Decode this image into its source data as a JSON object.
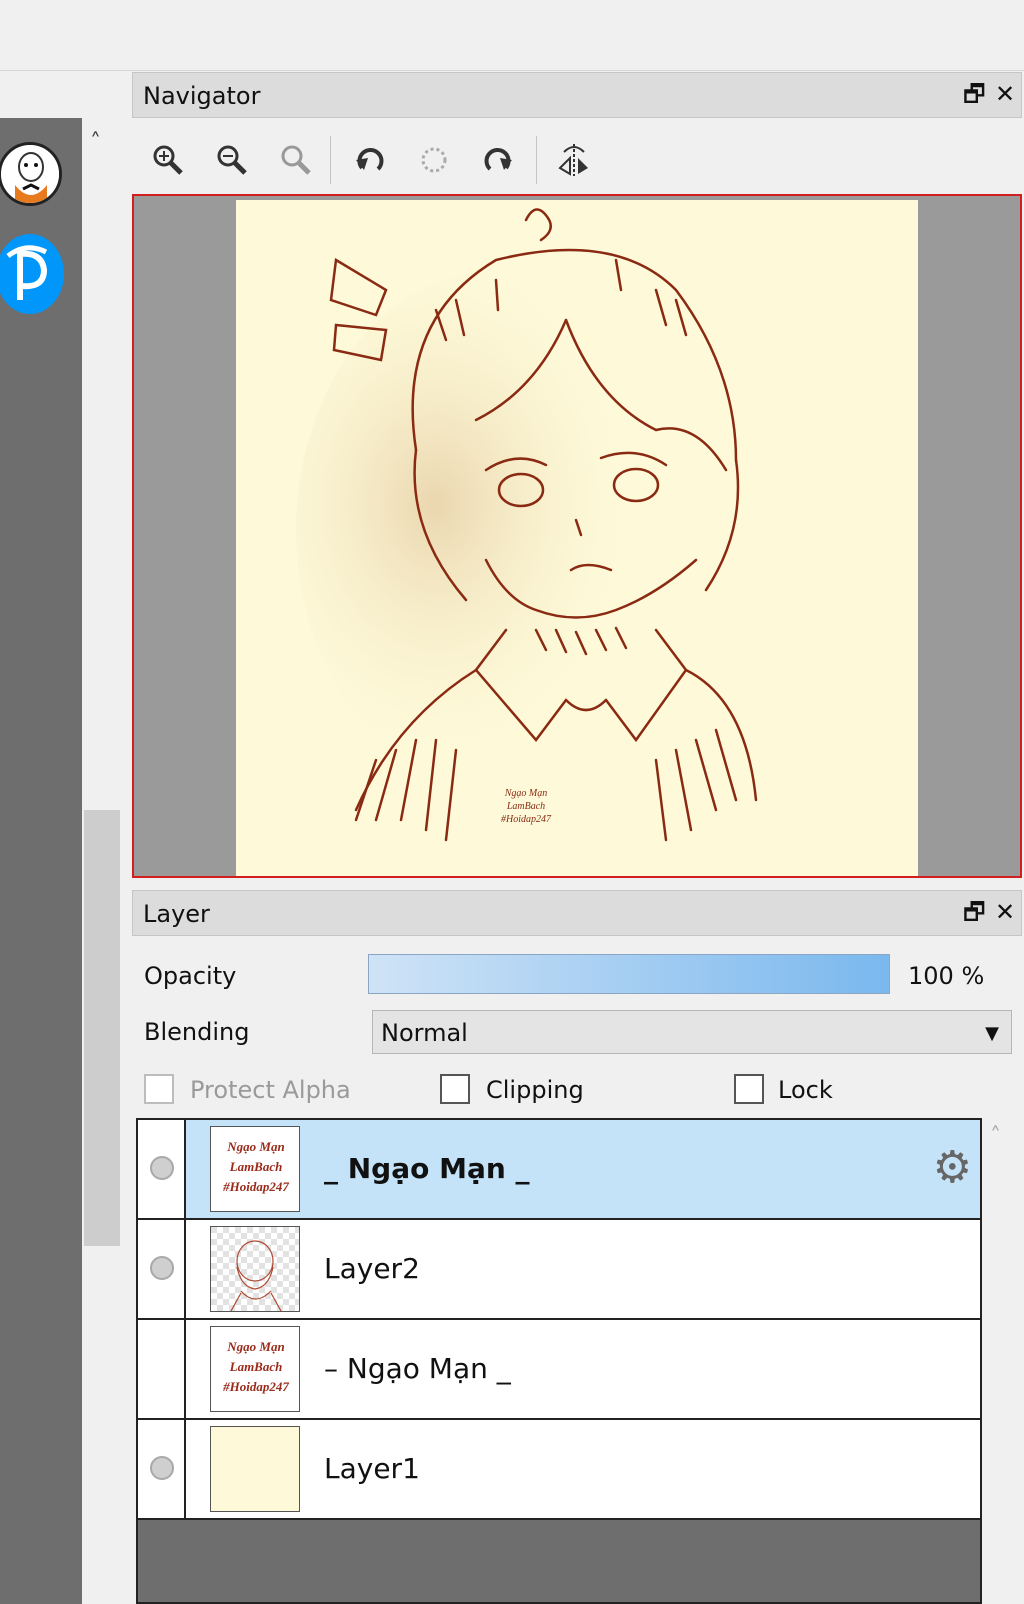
{
  "navigator": {
    "title": "Navigator",
    "restore_icon": "🗗",
    "close_icon": "✕",
    "tools": [
      "zoom-in-icon",
      "zoom-out-icon",
      "zoom-reset-icon",
      "rotate-left-icon",
      "rotate-reset-icon",
      "rotate-right-icon",
      "flip-horizontal-icon"
    ]
  },
  "sidebar": {
    "scroll_up": "˄",
    "items": [
      "alpaca-avatar",
      "pixiv-avatar"
    ]
  },
  "layer_panel": {
    "title": "Layer",
    "restore_icon": "🗗",
    "close_icon": "✕",
    "opacity_label": "Opacity",
    "opacity_value": "100 %",
    "opacity_fraction": 1.0,
    "blending_label": "Blending",
    "blending_value": "Normal",
    "dropdown_arrow": "▼",
    "protect_alpha_label": "Protect Alpha",
    "clipping_label": "Clipping",
    "lock_label": "Lock",
    "scroll_up": "˄",
    "gear_icon": "⚙",
    "layers": [
      {
        "name": "_ Ngạo Mạn _",
        "selected": true,
        "visible_dot": true
      },
      {
        "name": "Layer2",
        "selected": false,
        "visible_dot": true
      },
      {
        "name": "– Ngạo Mạn _",
        "selected": false,
        "visible_dot": false
      },
      {
        "name": "Layer1",
        "selected": false,
        "visible_dot": true
      }
    ],
    "thumb_text": [
      "Ngạo Mạn",
      "LamBach",
      "#Hoidap247"
    ]
  },
  "canvas": {
    "watermark": [
      "Ngạo Mạn",
      "LamBach",
      "#Hoidap247"
    ],
    "background_color": "#fefad9",
    "line_color": "#8a2a12"
  }
}
